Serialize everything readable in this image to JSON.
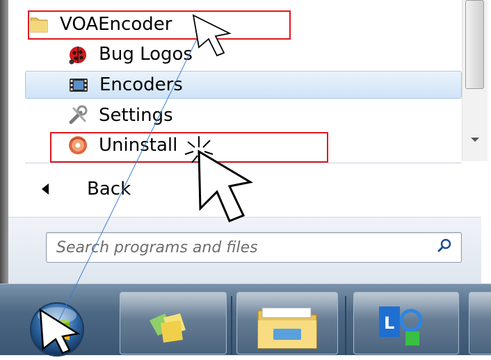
{
  "start_menu": {
    "folder": {
      "label": "VOAEncoder",
      "icon": "folder-icon"
    },
    "subitems": [
      {
        "label": "Bug Logos",
        "icon": "ladybug-icon"
      },
      {
        "label": "Encoders",
        "icon": "film-icon"
      },
      {
        "label": "Settings",
        "icon": "tools-icon"
      },
      {
        "label": "Uninstall",
        "icon": "uninstall-disc-icon"
      }
    ],
    "back_label": "Back",
    "search_placeholder": "Search programs and files",
    "highlight_color": "#e2161d",
    "selected_row_color": "#cfe3f7"
  },
  "taskbar": {
    "start_button": "windows-start-orb",
    "pinned": [
      "windows-explorer-icon",
      "file-explorer-folder-icon",
      "lync-icon"
    ]
  }
}
